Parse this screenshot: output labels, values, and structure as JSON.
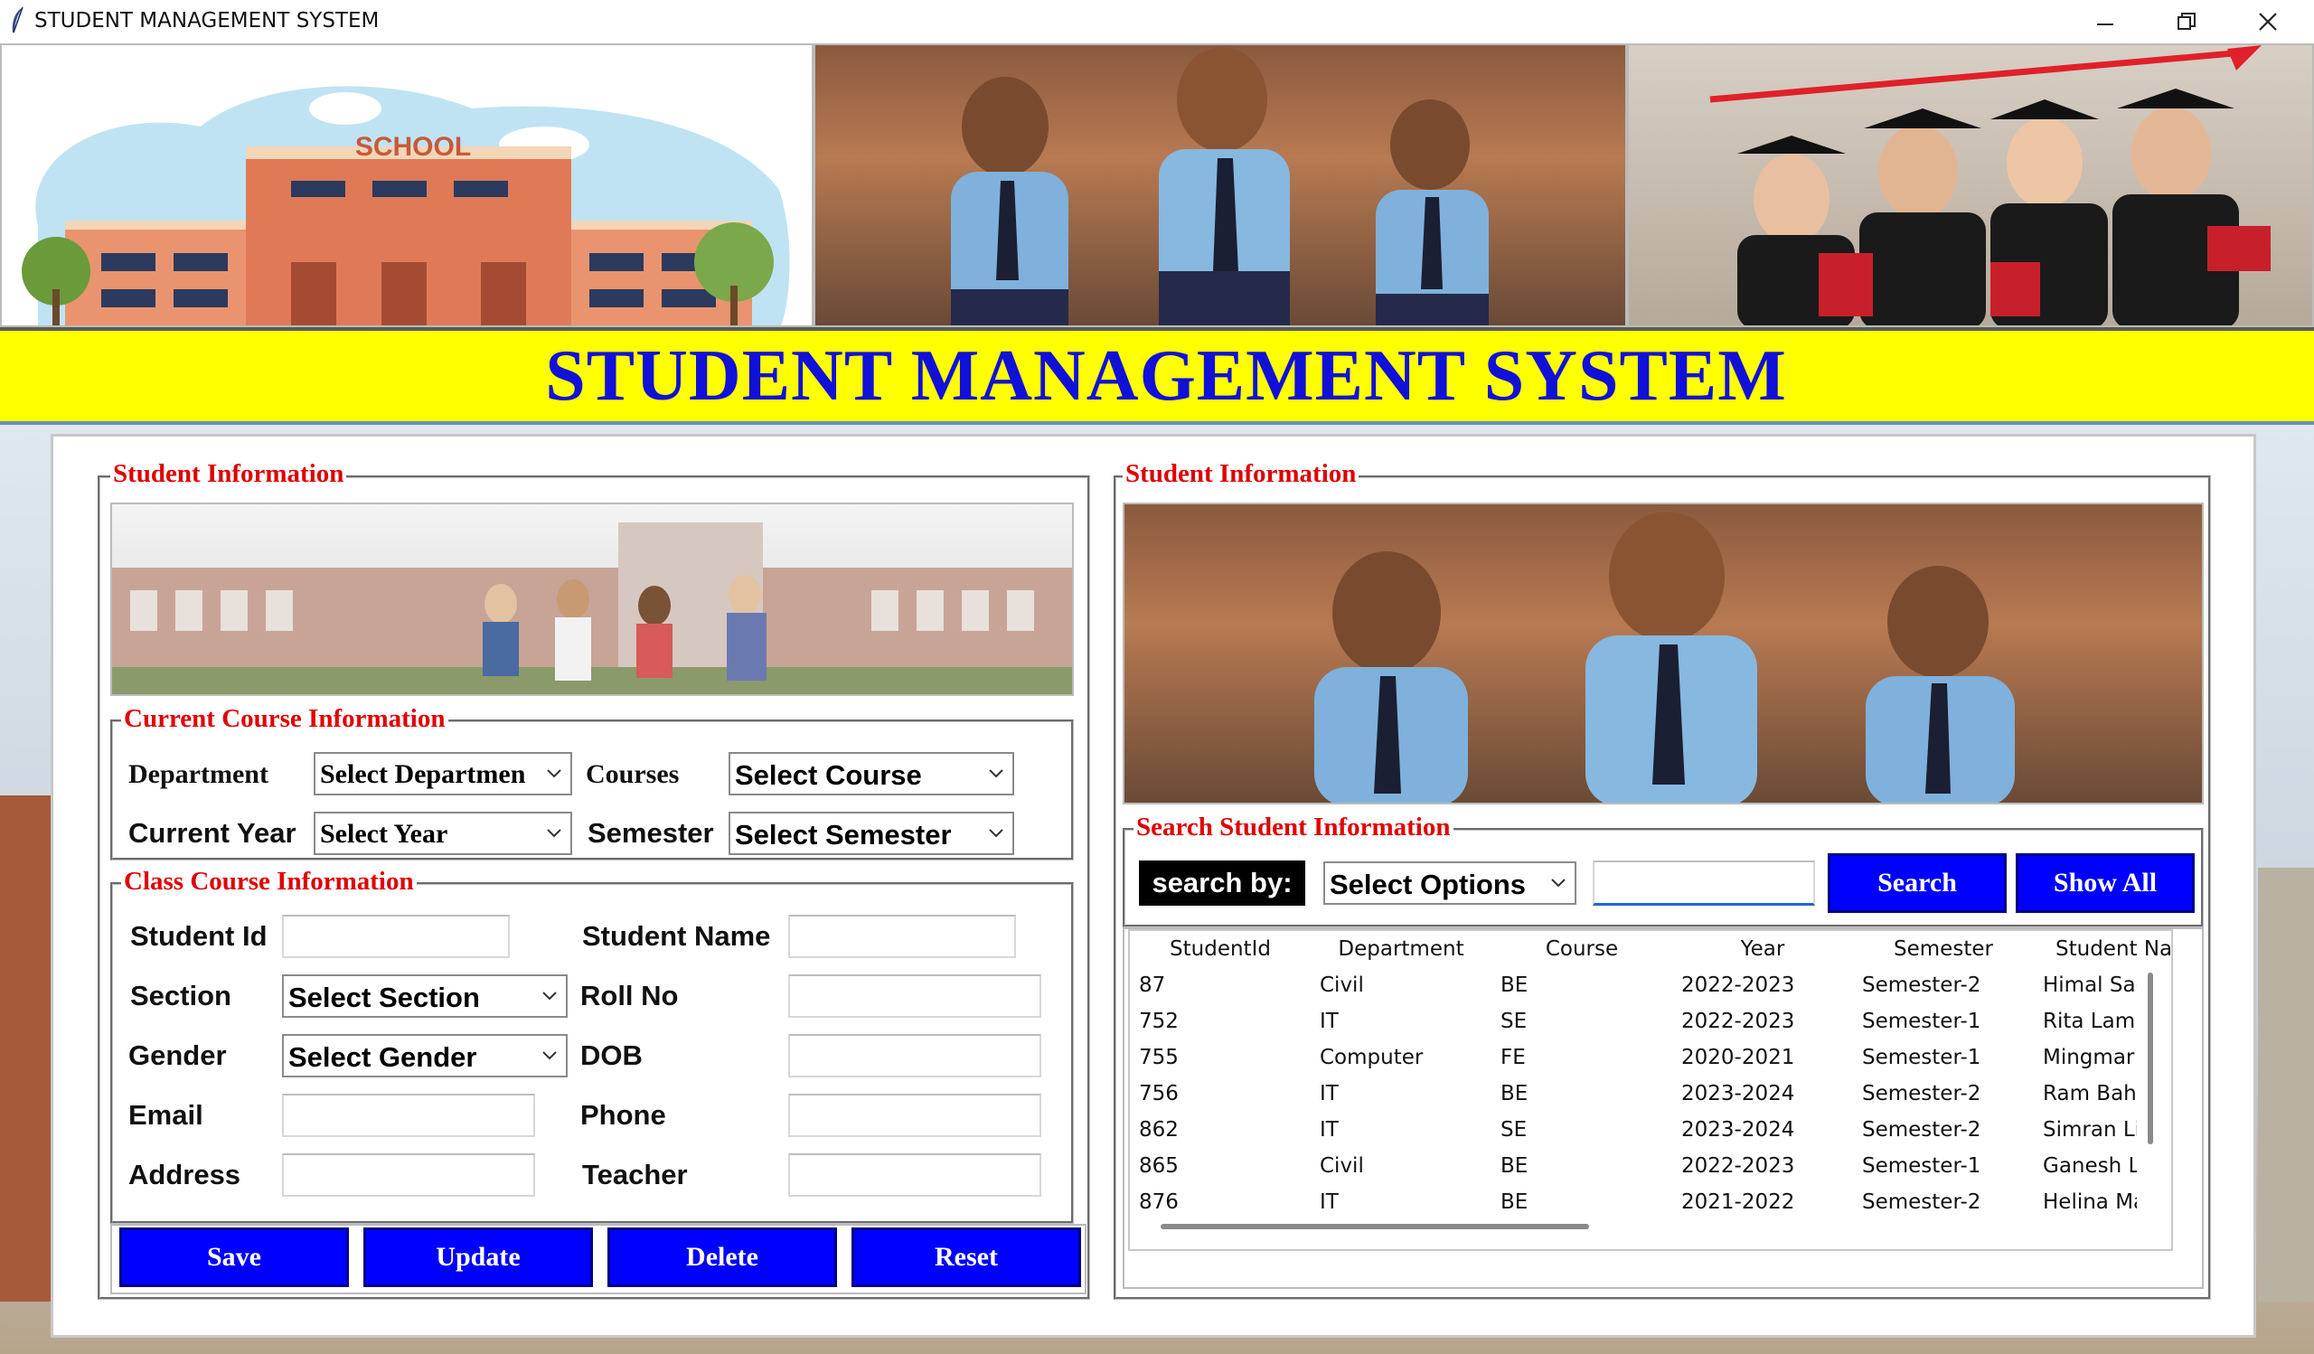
{
  "window": {
    "title": "STUDENT MANAGEMENT SYSTEM",
    "controls": {
      "minimize": "minimize-icon",
      "restore": "restore-icon",
      "close": "close-icon"
    }
  },
  "header_images": {
    "school_sign": "SCHOOL"
  },
  "banner": {
    "title": "STUDENT MANAGEMENT SYSTEM"
  },
  "colors": {
    "banner_bg": "#ffff00",
    "banner_text": "#1010d8",
    "frame_label": "#e00000",
    "button_bg": "#0000ff",
    "search_by_bg": "#000000"
  },
  "left_panel": {
    "title": "Student Information",
    "course_section": {
      "title": "Current Course Information",
      "department_label": "Department",
      "department_value": "Select Departmen",
      "courses_label": "Courses",
      "courses_value": "Select Course",
      "year_label": "Current Year",
      "year_value": "Select Year",
      "semester_label": "Semester",
      "semester_value": "Select Semester"
    },
    "class_section": {
      "title": "Class Course Information",
      "student_id_label": "Student Id",
      "student_name_label": "Student Name",
      "section_label": "Section",
      "section_value": "Select Section",
      "roll_no_label": "Roll No",
      "gender_label": "Gender",
      "gender_value": "Select Gender",
      "dob_label": "DOB",
      "email_label": "Email",
      "phone_label": "Phone",
      "address_label": "Address",
      "teacher_label": "Teacher"
    },
    "buttons": {
      "save": "Save",
      "update": "Update",
      "delete": "Delete",
      "reset": "Reset"
    }
  },
  "right_panel": {
    "title": "Student Information",
    "search_section": {
      "title": "Search Student Information",
      "search_by_label": "search by:",
      "options_value": "Select Options",
      "search_input_value": "",
      "search_button": "Search",
      "show_all_button": "Show All"
    },
    "table": {
      "columns": [
        "StudentId",
        "Department",
        "Course",
        "Year",
        "Semester",
        "Student Nar"
      ],
      "rows": [
        [
          "87",
          "Civil",
          "BE",
          "2022-2023",
          "Semester-2",
          "Himal Sagar"
        ],
        [
          "752",
          "IT",
          "SE",
          "2022-2023",
          "Semester-1",
          "Rita Lamichh"
        ],
        [
          "755",
          "Computer",
          "FE",
          "2020-2021",
          "Semester-1",
          "Mingmar Lan"
        ],
        [
          "756",
          "IT",
          "BE",
          "2023-2024",
          "Semester-2",
          "Ram Bahadur"
        ],
        [
          "862",
          "IT",
          "SE",
          "2023-2024",
          "Semester-2",
          "Simran Limbo"
        ],
        [
          "865",
          "Civil",
          "BE",
          "2022-2023",
          "Semester-1",
          "Ganesh Limb"
        ],
        [
          "876",
          "IT",
          "BE",
          "2021-2022",
          "Semester-2",
          "Helina Magar"
        ]
      ]
    }
  }
}
